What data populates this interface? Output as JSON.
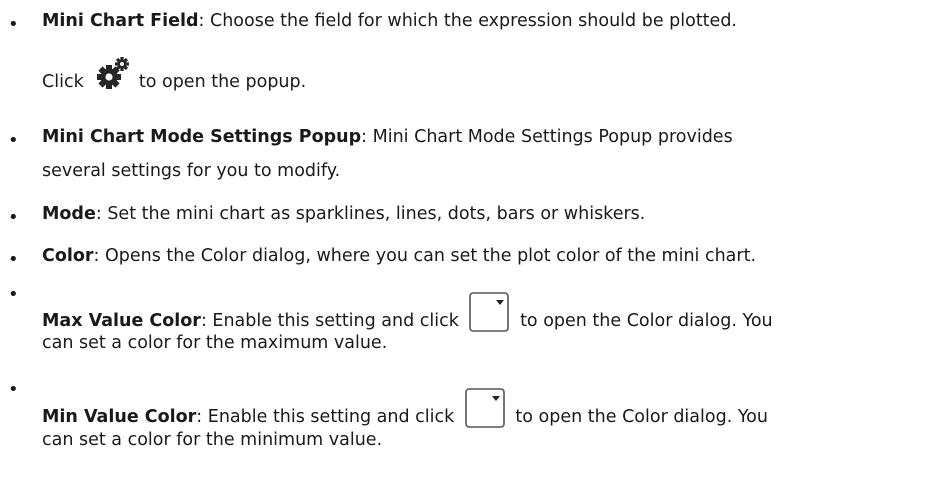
{
  "items": [
    {
      "term": "Mini Chart Field",
      "sep": ":",
      "line1": " Choose the field for which the expression should be plotted.",
      "line2_before": "Click",
      "line2_icon": "gear-icon",
      "line2_after": "to open the popup."
    },
    {
      "term": "Mini Chart Mode Settings Popup",
      "sep": ":",
      "line1": " Mini Chart Mode Settings Popup provides",
      "line2": "several settings for you to modify."
    },
    {
      "term": "Mode",
      "sep": ":",
      "line1": " Set the mini chart as sparklines, lines, dots, bars or whiskers."
    },
    {
      "term": "Color",
      "sep": ":",
      "line1": " Opens the Color dialog, where you can set the plot color of the mini chart."
    },
    {
      "term": "Max Value Color",
      "sep": ":",
      "line1_before": " Enable this setting and click",
      "line1_icon": "dropdown-icon",
      "line1_after": "to open the Color dialog. You",
      "line2": "can set a color for the maximum value."
    },
    {
      "term": "Min Value Color",
      "sep": ":",
      "line1_before": " Enable this setting and click",
      "line1_icon": "dropdown-icon",
      "line1_after": "to open the Color dialog. You",
      "line2": "can set a color for the minimum value."
    }
  ],
  "bullet_char": "•"
}
